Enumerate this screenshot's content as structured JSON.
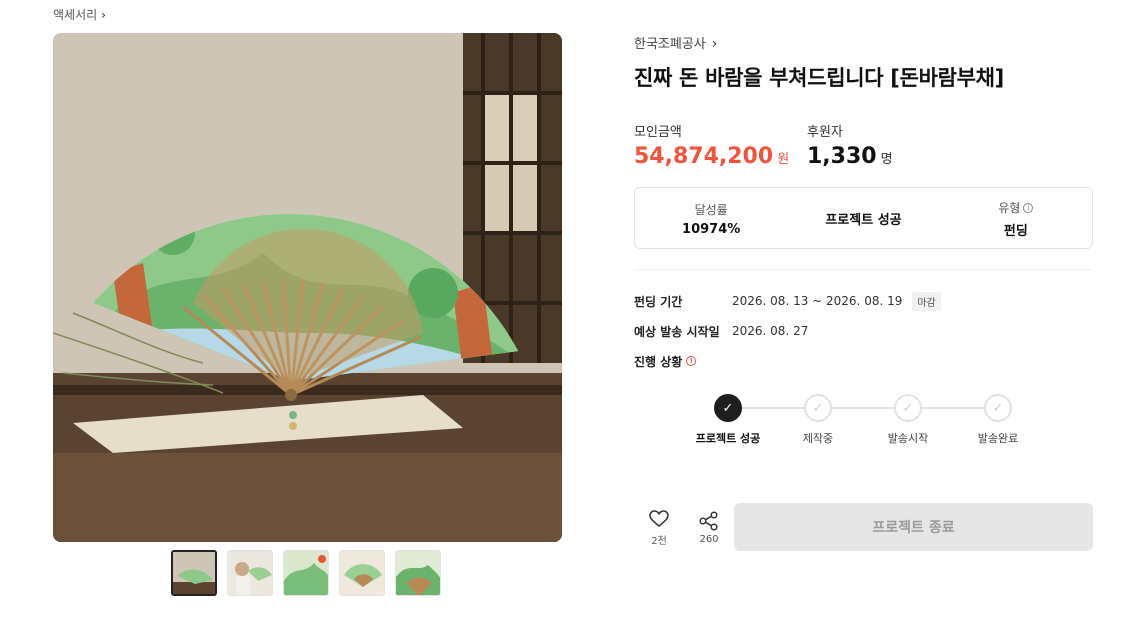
{
  "breadcrumb": {
    "category": "액세서리"
  },
  "product": {
    "maker": "한국조폐공사",
    "title": "진짜 돈 바람을 부쳐드립니다 [돈바람부채]"
  },
  "stats": {
    "amount_label": "모인금액",
    "amount_value": "54,874,200",
    "amount_unit": "원",
    "backers_label": "후원자",
    "backers_value": "1,330",
    "backers_unit": "명"
  },
  "info_box": {
    "rate_label": "달성률",
    "rate_value": "10974%",
    "status": "프로젝트 성공",
    "type_label": "유형",
    "type_value": "펀딩"
  },
  "meta": {
    "period_label": "펀딩 기간",
    "period_value": "2026. 08. 13 ~ 2026. 08. 19",
    "period_badge": "마감",
    "ship_label": "예상 발송 시작일",
    "ship_value": "2026. 08. 27",
    "progress_label": "진행 상황"
  },
  "progress_steps": [
    "프로젝트 성공",
    "제작중",
    "발송시작",
    "발송완료"
  ],
  "actions": {
    "like_count": "2천",
    "share_count": "260",
    "end_button": "프로젝트 종료"
  },
  "colors": {
    "accent": "#f0533e",
    "disabled_bg": "#e6e6e6",
    "step_done": "#1e1e1e"
  },
  "icons": [
    "chevron-right-icon",
    "info-icon",
    "alert-icon",
    "check-icon",
    "heart-icon",
    "share-icon"
  ]
}
